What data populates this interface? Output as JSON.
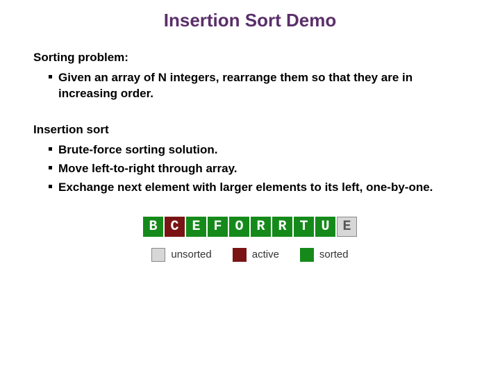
{
  "title": "Insertion Sort Demo",
  "section1": {
    "heading": "Sorting problem:",
    "bullets": [
      "Given an array of N integers, rearrange them so that they are in increasing order."
    ]
  },
  "section2": {
    "heading": "Insertion sort",
    "bullets": [
      "Brute-force sorting solution.",
      "Move left-to-right through array.",
      "Exchange next element with larger elements to its left, one-by-one."
    ]
  },
  "cells": [
    {
      "letter": "B",
      "state": "sorted"
    },
    {
      "letter": "C",
      "state": "active"
    },
    {
      "letter": "E",
      "state": "sorted"
    },
    {
      "letter": "F",
      "state": "sorted"
    },
    {
      "letter": "O",
      "state": "sorted"
    },
    {
      "letter": "R",
      "state": "sorted"
    },
    {
      "letter": "R",
      "state": "sorted"
    },
    {
      "letter": "T",
      "state": "sorted"
    },
    {
      "letter": "U",
      "state": "sorted"
    },
    {
      "letter": "E",
      "state": "unsorted"
    }
  ],
  "legend": {
    "unsorted": "unsorted",
    "active": "active",
    "sorted": "sorted"
  }
}
